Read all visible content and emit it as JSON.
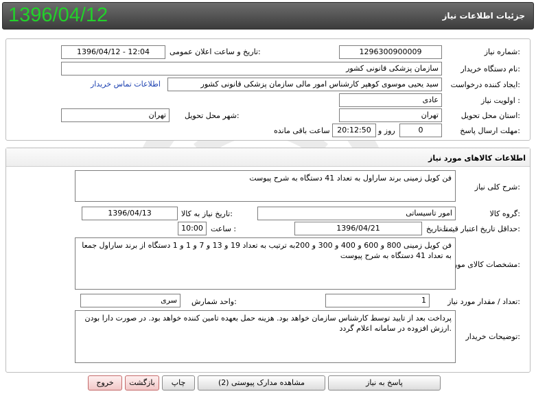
{
  "header": {
    "title": "جزئیات اطلاعات نیاز",
    "date": "1396/04/12"
  },
  "need_info": {
    "need_number_label": "شماره نیاز:",
    "need_number": "1296300900009",
    "announce_label": "تاریخ و ساعت اعلان عمومی:",
    "announce_value": "1396/04/12 - 12:04",
    "buyer_label": "نام دستگاه خریدار:",
    "buyer_value": "سازمان پزشکی قانونی کشور",
    "creator_label": "ایجاد کننده درخواست:",
    "creator_value": "سید یحیی موسوی کوهپر کارشناس امور مالی سازمان پزشکی قانونی کشور",
    "contact_link": "اطلاعات تماس خریدار",
    "priority_label": "اولویت نیاز :",
    "priority_value": "عادی",
    "province_label": "استان محل تحویل:",
    "province_value": "تهران",
    "city_label": "شهر محل تحویل:",
    "city_value": "تهران",
    "deadline_label": "مهلت ارسال پاسخ:",
    "days_value": "0",
    "days_unit": "روز و",
    "time_value": "20:12:50",
    "remaining_label": "ساعت باقی مانده"
  },
  "goods": {
    "section_title": "اطلاعات کالاهای مورد نیاز",
    "summary_label": "شرح کلی نیاز:",
    "summary_value": "فن کویل زمینی برند ساراول به تعداد 41 دستگاه به شرح پیوست",
    "group_label": "گروه کالا:",
    "group_value": "امور تاسیساتی",
    "need_date_label": "تاریخ نیاز به کالا:",
    "need_date_value": "1396/04/13",
    "validity_label": "حداقل تاریخ اعتبار قیمت:",
    "until_label": "تا تاریخ :",
    "until_value": "1396/04/21",
    "hour_label": "ساعت :",
    "hour_value": "10:00",
    "spec_label": "مشخصات کالای مورد نیاز:",
    "spec_value": "فن کویل زمینی 800 و 600 و 400 و 300 و 200به ترتیب به تعداد 19 و 13 و 7 و 1 و 1 دستگاه از برند ساراول جمعا به تعداد 41 دستگاه به شرح پیوست",
    "qty_label": "تعداد / مقدار مورد نیاز:",
    "qty_value": "1",
    "unit_label": "واحد شمارش:",
    "unit_value": "سری",
    "notes_label": "توضیحات خریدار:",
    "notes_value": "پرداخت بعد از تایید توسط کارشناس سازمان خواهد بود. هزینه حمل بعهده تامین کننده خواهد بود. در صورت دارا بودن ارزش افزوده در سامانه اعلام گردد."
  },
  "buttons": {
    "respond": "پاسخ به نیاز",
    "attachments": "مشاهده مدارک پیوستی (2)",
    "print": "چاپ",
    "back": "بازگشت",
    "exit": "خروج"
  },
  "colors": {
    "header_date": "#22d12a",
    "link": "#1a3fb0",
    "exit_button": "#f1c7c7"
  }
}
